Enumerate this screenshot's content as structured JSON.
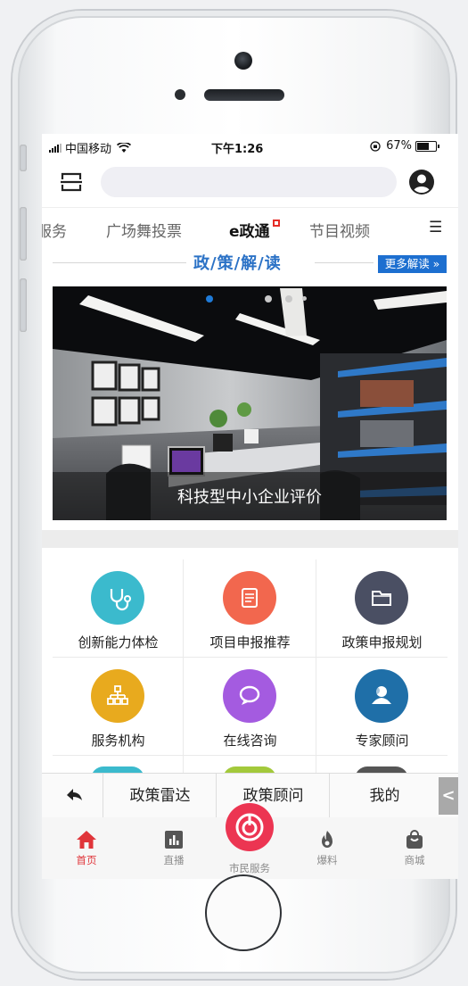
{
  "status_bar": {
    "carrier": "中国移动",
    "time": "下午1:26",
    "battery": "67%",
    "battery_level": 0.67
  },
  "header": {
    "search_placeholder": ""
  },
  "tabs": [
    {
      "label": "服务"
    },
    {
      "label": "广场舞投票"
    },
    {
      "label": "e政通",
      "active": true
    },
    {
      "label": "节目视频"
    }
  ],
  "tabs_more": "☰",
  "policy": {
    "title": "政/策/解/读",
    "more": "更多解读 »"
  },
  "banner": {
    "caption": "科技型中小企业评价",
    "slide_count": 4,
    "active_slide": 0
  },
  "grid": [
    {
      "label": "创新能力体检",
      "icon": "stethoscope-icon",
      "color": "#3bbacd"
    },
    {
      "label": "项目申报推荐",
      "icon": "document-icon",
      "color": "#f2674e"
    },
    {
      "label": "政策申报规划",
      "icon": "folder-icon",
      "color": "#4a4f63"
    },
    {
      "label": "服务机构",
      "icon": "org-chart-icon",
      "color": "#e8aa1e"
    },
    {
      "label": "在线咨询",
      "icon": "chat-bubble-icon",
      "color": "#a45be0"
    },
    {
      "label": "专家顾问",
      "icon": "expert-icon",
      "color": "#1f6fa8"
    }
  ],
  "float_menu": {
    "items": [
      "政策雷达",
      "政策顾问",
      "我的"
    ],
    "toggle": "<"
  },
  "bottom_nav": [
    {
      "label": "首页",
      "icon": "home-icon",
      "active": true
    },
    {
      "label": "直播",
      "icon": "chart-icon"
    },
    {
      "label": "市民服务",
      "icon": "citizen-service-icon"
    },
    {
      "label": "爆料",
      "icon": "flame-icon"
    },
    {
      "label": "商城",
      "icon": "shopping-bag-icon"
    }
  ],
  "colors": {
    "accent": "#2b72c6",
    "active": "#e0353a",
    "center": "#ec3552"
  }
}
